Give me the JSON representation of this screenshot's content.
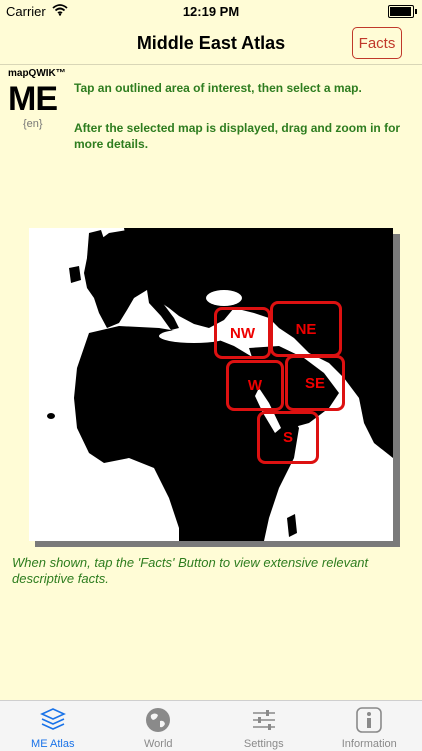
{
  "status_bar": {
    "carrier": "Carrier",
    "time": "12:19 PM",
    "battery_level": 0.95
  },
  "nav": {
    "title": "Middle East Atlas",
    "facts_label": "Facts"
  },
  "logo": {
    "brand": "mapQWIK™",
    "code": "ME",
    "lang": "{en}"
  },
  "instructions": {
    "line1": "Tap an outlined area of interest, then select a map.",
    "line2": "After the selected map is displayed, drag and zoom in for more details."
  },
  "regions": [
    {
      "label": "NW"
    },
    {
      "label": "NE"
    },
    {
      "label": "W"
    },
    {
      "label": "SE"
    },
    {
      "label": "S"
    }
  ],
  "bottom_note": "When shown, tap the 'Facts' Button to view extensive relevant descriptive facts.",
  "tabs": [
    {
      "label": "ME Atlas",
      "icon": "layers-icon",
      "active": true
    },
    {
      "label": "World",
      "icon": "globe-icon",
      "active": false
    },
    {
      "label": "Settings",
      "icon": "sliders-icon",
      "active": false
    },
    {
      "label": "Information",
      "icon": "info-icon",
      "active": false
    }
  ],
  "colors": {
    "accent_red": "#d11111",
    "instruction_green": "#2e7d1f",
    "active_tab": "#1a73e8",
    "background": "#fffcd6"
  }
}
